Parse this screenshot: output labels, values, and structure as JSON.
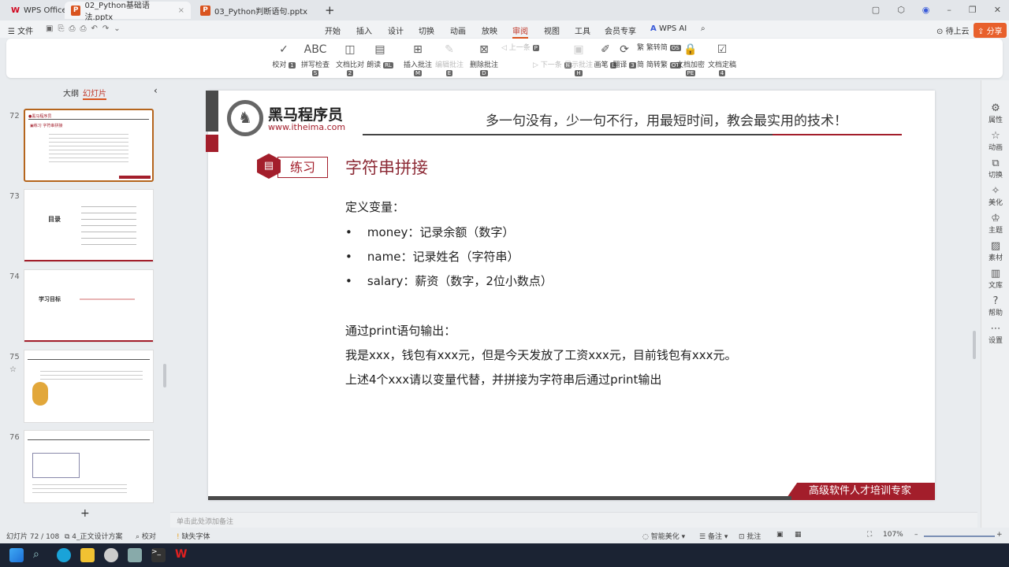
{
  "tabs": {
    "home": "WPS Office",
    "t1": "02_Python基础语法.pptx",
    "t2": "03_Python判断语句.pptx",
    "new": "+"
  },
  "menu": {
    "file": "文件",
    "items": [
      "开始",
      "插入",
      "设计",
      "切换",
      "动画",
      "放映",
      "审阅",
      "视图",
      "工具",
      "会员专享"
    ],
    "ai": "WPS AI",
    "cloud": "待上云",
    "share": "分享"
  },
  "ribbon": [
    {
      "label": "校对",
      "key": "1",
      "icon": "✓"
    },
    {
      "label": "拼写检查",
      "key": "S",
      "icon": "ABC"
    },
    {
      "label": "文档比对",
      "key": "2",
      "icon": "◫"
    },
    {
      "label": "朗读",
      "key": "RL",
      "icon": "▤"
    },
    {
      "label": "插入批注",
      "key": "M",
      "icon": "⊞"
    },
    {
      "label": "编辑批注",
      "key": "E",
      "icon": "✎"
    },
    {
      "label": "删除批注",
      "key": "D",
      "icon": "⊠"
    },
    {
      "label": "上一条",
      "key": "P",
      "icon": "◁"
    },
    {
      "label": "下一条",
      "key": "N",
      "icon": "▷"
    },
    {
      "label": "显示批注",
      "key": "H",
      "icon": "▣"
    },
    {
      "label": "画笔",
      "key": "L",
      "icon": "✐"
    },
    {
      "label": "翻译",
      "key": "3",
      "icon": "⟳"
    },
    {
      "label": "繁转简",
      "key": "OS",
      "icon": "繁"
    },
    {
      "label": "简转繁",
      "key": "OT",
      "icon": "简"
    },
    {
      "label": "文档加密",
      "key": "PE",
      "icon": "🔒"
    },
    {
      "label": "文档定稿",
      "key": "4",
      "icon": "☑"
    }
  ],
  "panel": {
    "outline": "大纲",
    "slides": "幻灯片",
    "thumbs": [
      "72",
      "73",
      "74",
      "75",
      "76"
    ],
    "t73": "目录",
    "t74": "学习目标",
    "add": "+"
  },
  "slide": {
    "brand": "黑马程序员",
    "url": "www.itheima.com",
    "slogan": "多一句没有，少一句不行，用最短时间，教会最实用的技术！",
    "tag": "练习",
    "title": "字符串拼接",
    "define": "定义变量：",
    "bullets": [
      "money：记录余额（数字）",
      "name：记录姓名（字符串）",
      "salary：薪资（数字，2位小数点）"
    ],
    "output_label": "通过print语句输出：",
    "output_line": "我是xxx，钱包有xxx元，但是今天发放了工资xxx元，目前钱包有xxx元。",
    "task": "上述4个xxx请以变量代替，并拼接为字符串后通过print输出",
    "footer": "高级软件人才培训专家"
  },
  "rightbar": [
    "属性",
    "动画",
    "切换",
    "美化",
    "主题",
    "素材",
    "文库",
    "帮助",
    "设置"
  ],
  "notes": "单击此处添加备注",
  "status": {
    "slide": "幻灯片 72 / 108",
    "theme": "4_正文设计方案",
    "proof": "校对",
    "font": "缺失字体",
    "beautify": "智能美化",
    "notes": "备注",
    "comments": "批注",
    "zoom": "107%"
  },
  "colors": {
    "accent": "#d9531e",
    "brand_red": "#a31e2b"
  }
}
